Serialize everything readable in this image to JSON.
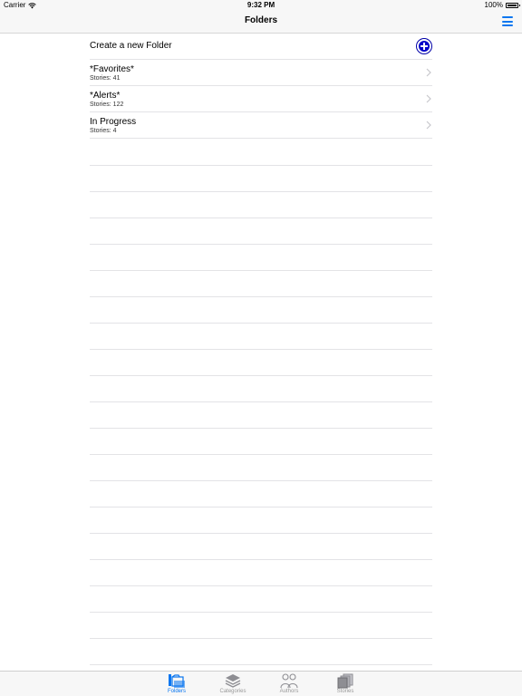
{
  "status_bar": {
    "carrier": "Carrier",
    "time": "9:32 PM",
    "battery": "100%"
  },
  "nav": {
    "title": "Folders"
  },
  "create_row": {
    "label": "Create a new Folder"
  },
  "folders": [
    {
      "name": "*Favorites*",
      "count": "Stories: 41"
    },
    {
      "name": "*Alerts*",
      "count": "Stories: 122"
    },
    {
      "name": "In Progress",
      "count": "Stories: 4"
    }
  ],
  "tabs": [
    {
      "label": "Folders",
      "icon": "folders-icon",
      "active": true
    },
    {
      "label": "Categories",
      "icon": "layers-icon",
      "active": false
    },
    {
      "label": "Authors",
      "icon": "people-icon",
      "active": false
    },
    {
      "label": "Stories",
      "icon": "documents-icon",
      "active": false
    }
  ],
  "colors": {
    "accent": "#0a76f0",
    "add_button": "#0000c8",
    "separator": "#e3e3e6"
  }
}
